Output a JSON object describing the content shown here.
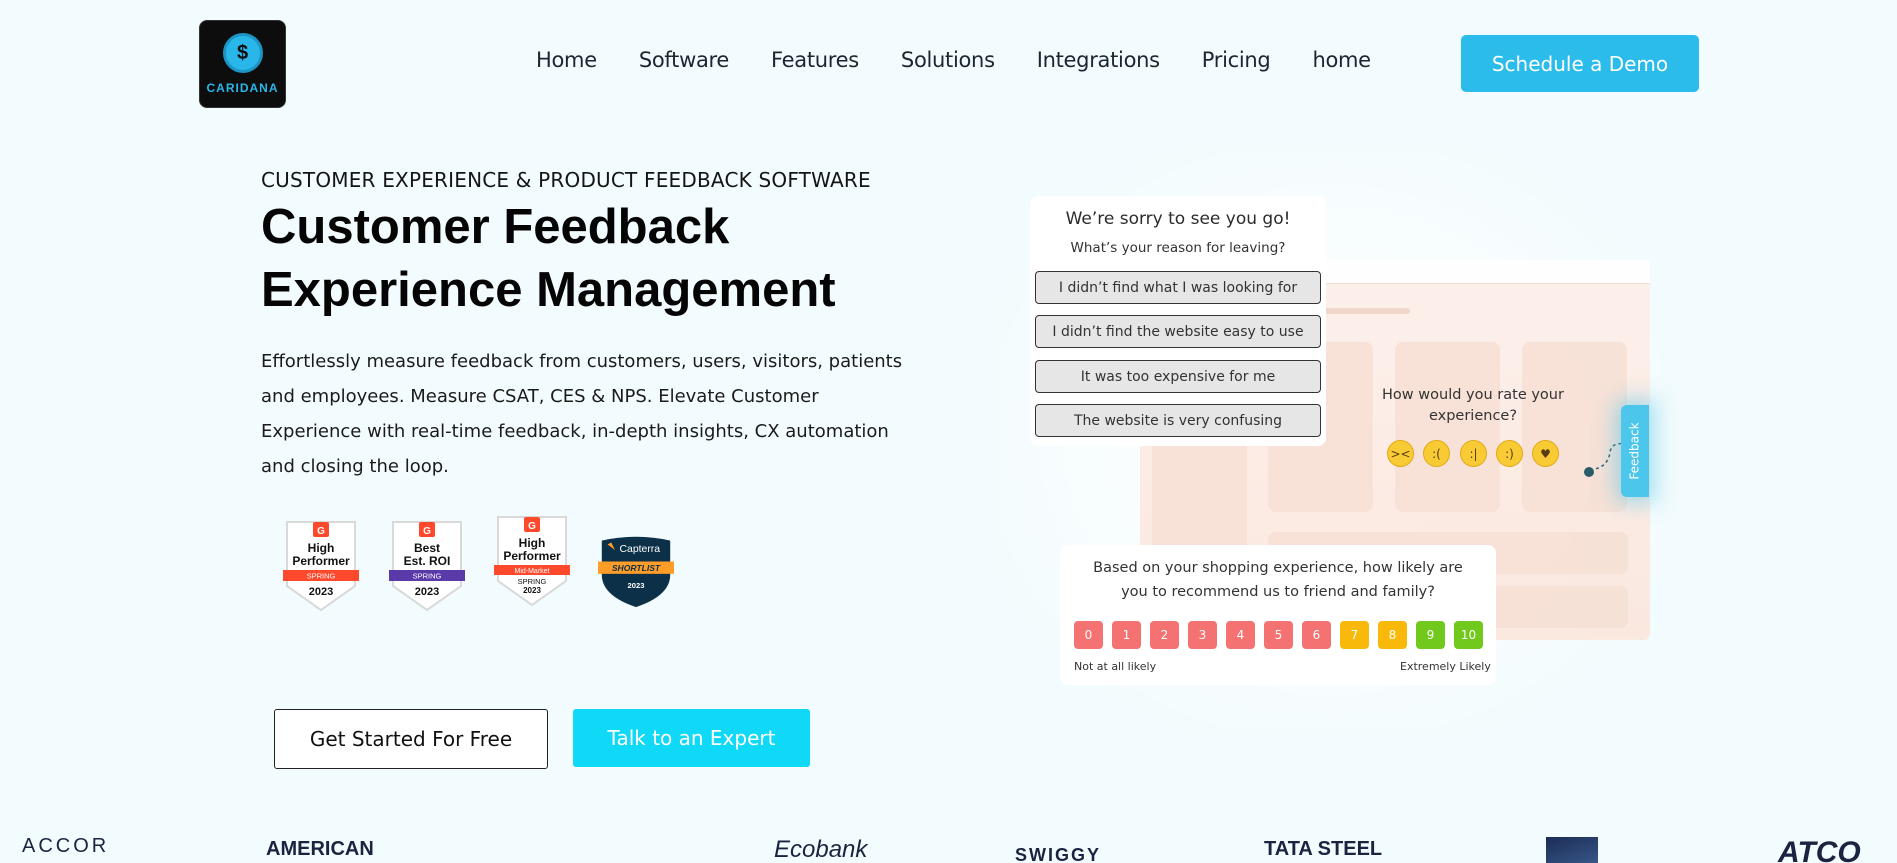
{
  "header": {
    "logo_text": "CARIDANA",
    "nav": [
      "Home",
      "Software",
      "Features",
      "Solutions",
      "Integrations",
      "Pricing",
      "home"
    ],
    "demo_button": "Schedule a Demo"
  },
  "hero": {
    "eyebrow": "CUSTOMER EXPERIENCE & PRODUCT FEEDBACK SOFTWARE",
    "title": "Customer Feedback Experience Management",
    "description": "Effortlessly measure feedback from customers, users, visitors, patients and employees. Measure CSAT, CES & NPS. Elevate Customer Experience with real-time feedback, in-depth insights, CX automation and closing the loop.",
    "cta_primary": "Get Started For Free",
    "cta_secondary": "Talk to an Expert"
  },
  "badges": [
    {
      "line1": "High",
      "line2": "Performer",
      "ribbon": "SPRING",
      "year": "2023",
      "ribbon_color": "#ff492c"
    },
    {
      "line1": "Best",
      "line2": "Est. ROI",
      "ribbon": "SPRING",
      "year": "2023",
      "ribbon_color": "#5a39a8"
    },
    {
      "line1": "High",
      "line2": "Performer",
      "ribbon": "Mid-Market",
      "season": "SPRING",
      "year": "2023",
      "ribbon_color": "#ff492c"
    },
    {
      "brand": "Capterra",
      "ribbon": "SHORTLIST",
      "year": "2023"
    }
  ],
  "exit_survey": {
    "title": "We’re sorry to see you go!",
    "subtitle": "What’s your reason for leaving?",
    "options": [
      "I didn’t find what I was looking for",
      "I didn’t find the website easy to use",
      "It was too expensive for me",
      "The website is very confusing"
    ]
  },
  "rating_widget": {
    "question": "How would you rate your experience?",
    "feedback_tab": "Feedback",
    "emojis": [
      "tired-face-icon",
      "frown-face-icon",
      "neutral-face-icon",
      "smile-face-icon",
      "heart-eyes-icon"
    ]
  },
  "nps": {
    "question": "Based on your shopping experience, how likely are you to recommend us to friend and family?",
    "scores": [
      "0",
      "1",
      "2",
      "3",
      "4",
      "5",
      "6",
      "7",
      "8",
      "9",
      "10"
    ],
    "colors": [
      "#f47272",
      "#f47272",
      "#f47272",
      "#f47272",
      "#f47272",
      "#f47272",
      "#f47272",
      "#f8b90a",
      "#f8b90a",
      "#71c91d",
      "#71c91d"
    ],
    "low_label": "Not at all likely",
    "high_label": "Extremely Likely"
  },
  "client_logos": [
    "ACCOR",
    "AMERICAN",
    "Ecobank",
    "SWIGGY",
    "TATA STEEL",
    "ATCO"
  ]
}
